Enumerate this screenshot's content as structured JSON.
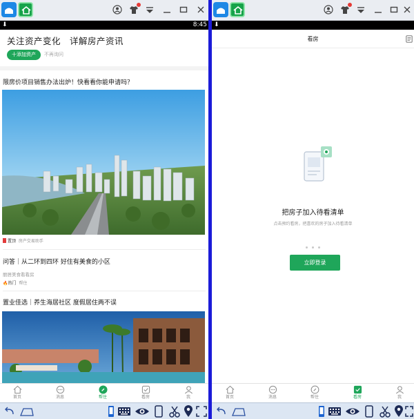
{
  "left": {
    "status_time": "8:45",
    "follow": {
      "title": "关注资产变化　详解房产资讯",
      "add_button": "十添加资产",
      "skip": "不再询问"
    },
    "articles": [
      {
        "title": "限房价项目销售办法出炉！快看看你能申请吗？",
        "tag": "置顶",
        "author": "房产交易助手"
      },
      {
        "title": "问答｜从二环到四环 好住有美食的小区",
        "sub": "丽居美食看看房",
        "tag": "热门",
        "author": "帮住"
      },
      {
        "title": "置业佳选｜养生海居社区 度假居住两不误"
      }
    ],
    "tabs": [
      {
        "label": "首页"
      },
      {
        "label": "消息"
      },
      {
        "label": "帮住"
      },
      {
        "label": "看房"
      },
      {
        "label": "我"
      }
    ]
  },
  "right": {
    "header_title": "看房",
    "empty_title": "把房子加入待看清单",
    "empty_sub": "点击预约看房，把喜欢的房子加入待看清单",
    "login_button": "立即登录",
    "tabs": [
      {
        "label": "首页"
      },
      {
        "label": "消息"
      },
      {
        "label": "帮住"
      },
      {
        "label": "看房"
      },
      {
        "label": "我"
      }
    ]
  },
  "colors": {
    "accent": "#1fa65a",
    "divider": "#1b1bd8"
  }
}
